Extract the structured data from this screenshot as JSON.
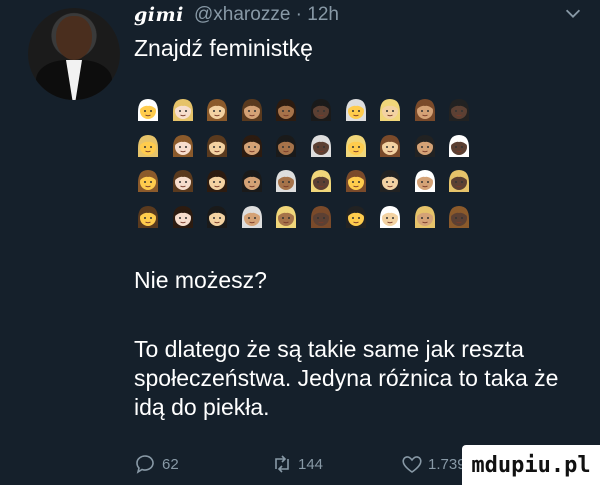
{
  "tweet": {
    "display_name": "gimi",
    "handle_time": "@xharozze · 12h",
    "text_line1": "Znajdź feministkę",
    "text_question": "Nie możesz?",
    "text_body": "To dlatego że są takie same jak reszta społeczeństwa. Jedyna różnica to taka że idą do piekła."
  },
  "icons": {
    "avatar": "person-avatar",
    "menu": "chevron-down-icon",
    "reply": "reply-icon",
    "retweet": "retweet-icon",
    "like": "heart-icon",
    "emoji": "woman-face-emoji"
  },
  "stats": {
    "replies": "62",
    "retweets": "144",
    "likes": "1.739"
  },
  "watermark": "mdupiu.pl",
  "emoji_grid": {
    "rows": 4,
    "columns": 10,
    "skin_tones": [
      "#ffcc4d",
      "#f7dece",
      "#f3d2a2",
      "#d4a276",
      "#a6734a",
      "#5c4033",
      "#ffcc4d",
      "#f3d2a2",
      "#d4a276",
      "#5c4033"
    ],
    "hair_colors": [
      "#ffffff",
      "#e6c36a",
      "#8b5a2b",
      "#5a3a1e",
      "#2c1b10",
      "#1a1a1a",
      "#dedede",
      "#f0d67a",
      "#7a4a2a",
      "#222222"
    ]
  },
  "colors": {
    "background": "#15202b",
    "text": "#ffffff",
    "muted": "#8899a6"
  }
}
